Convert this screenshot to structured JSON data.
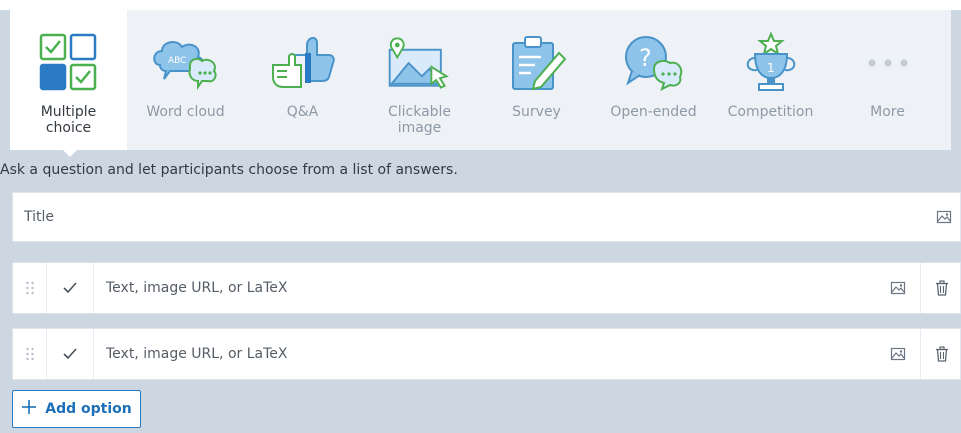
{
  "question_types": [
    {
      "label": "Multiple choice",
      "icon": "multiple-choice-icon",
      "active": true
    },
    {
      "label": "Word cloud",
      "icon": "word-cloud-icon"
    },
    {
      "label": "Q&A",
      "icon": "thumbs-icon"
    },
    {
      "label": "Clickable image",
      "icon": "clickable-image-icon"
    },
    {
      "label": "Survey",
      "icon": "survey-icon"
    },
    {
      "label": "Open-ended",
      "icon": "open-ended-icon"
    },
    {
      "label": "Competition",
      "icon": "trophy-icon"
    },
    {
      "label": "More",
      "icon": "more-dots-icon"
    }
  ],
  "icon_text": {
    "word_cloud": "ABC",
    "competition": "1"
  },
  "description": "Ask a question and let participants choose from a list of answers.",
  "title_field": {
    "placeholder": "Title"
  },
  "options": [
    {
      "placeholder": "Text, image URL, or LaTeX"
    },
    {
      "placeholder": "Text, image URL, or LaTeX"
    }
  ],
  "add_option": {
    "label": "Add option"
  },
  "colors": {
    "accent_blue": "#2a7ac4",
    "green": "#4caf50",
    "icon_blue": "#8ec3ea",
    "icon_stroke": "#4a93c9"
  }
}
